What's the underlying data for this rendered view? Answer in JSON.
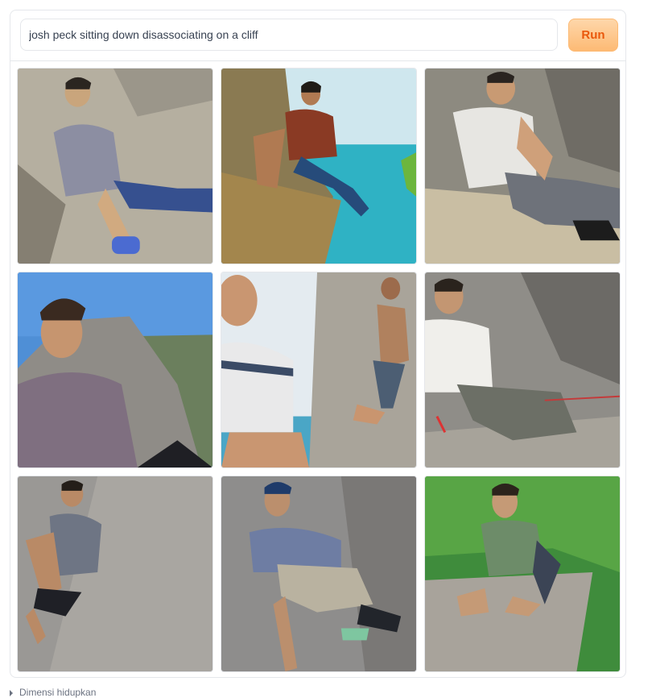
{
  "prompt": {
    "value": "josh peck sitting down disassociating on a cliff"
  },
  "run_button": {
    "label": "Run"
  },
  "footer": {
    "label": "Dimensi hidupkan"
  },
  "images": [
    {
      "alt": "generated image 1"
    },
    {
      "alt": "generated image 2"
    },
    {
      "alt": "generated image 3"
    },
    {
      "alt": "generated image 4"
    },
    {
      "alt": "generated image 5"
    },
    {
      "alt": "generated image 6"
    },
    {
      "alt": "generated image 7"
    },
    {
      "alt": "generated image 8"
    },
    {
      "alt": "generated image 9"
    }
  ]
}
